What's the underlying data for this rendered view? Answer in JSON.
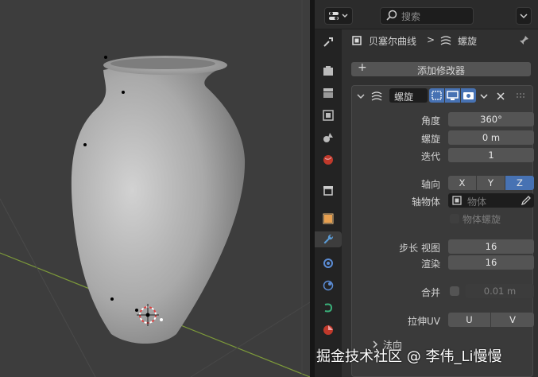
{
  "header": {
    "search_placeholder": "搜索"
  },
  "breadcrumb": {
    "object": "贝塞尔曲线",
    "separator": ">",
    "modifier": "螺旋"
  },
  "add_modifier_label": "添加修改器",
  "modifier": {
    "name": "螺旋",
    "angle_label": "角度",
    "angle_value": "360°",
    "screw_label": "螺旋",
    "screw_value": "0 m",
    "iterations_label": "迭代",
    "iterations_value": "1",
    "axis_label": "轴向",
    "axis_options": [
      "X",
      "Y",
      "Z"
    ],
    "axis_selected": "Z",
    "axis_object_label": "轴物体",
    "axis_object_placeholder": "物体",
    "object_screw_label": "物体螺旋",
    "steps_label": "步长 视图",
    "steps_viewport_value": "16",
    "render_label": "渲染",
    "render_value": "16",
    "merge_label": "合并",
    "merge_value": "0.01 m",
    "stretch_uv_label": "拉伸UV",
    "stretch_u": "U",
    "stretch_v": "V",
    "normals_label": "法向"
  },
  "tabs": [
    "tool-icon",
    "render-icon",
    "output-icon",
    "view-layer-icon",
    "scene-icon",
    "world-icon",
    "collection-icon",
    "object-icon",
    "modifier-wrench-icon",
    "particles-icon",
    "physics-icon",
    "constraints-icon",
    "data-icon"
  ],
  "active_tab": "modifier-wrench-icon",
  "colors": {
    "accent": "#4772b3",
    "viewport": "#3d3d3d",
    "panel": "#303030"
  },
  "watermark": "掘金技术社区 @ 李伟_Li慢慢"
}
